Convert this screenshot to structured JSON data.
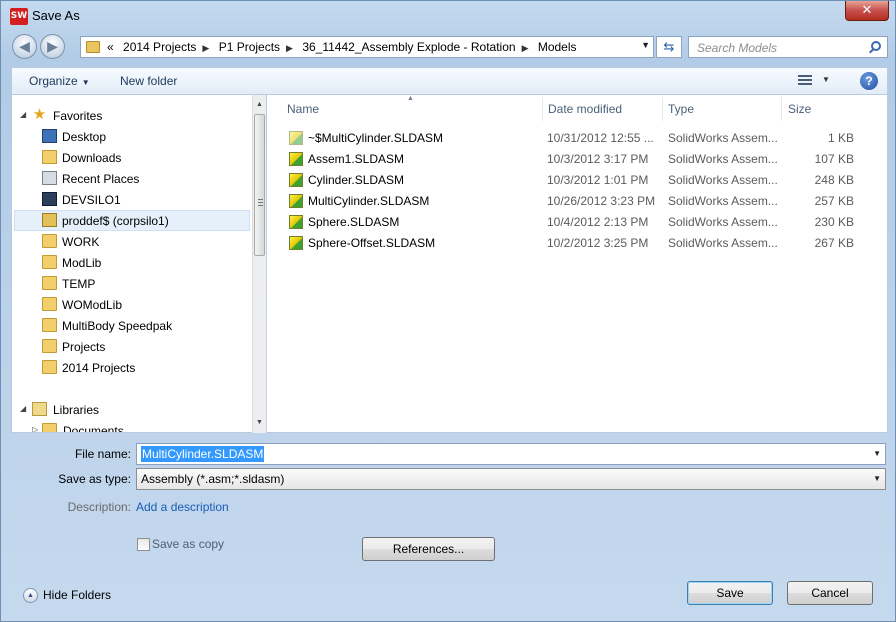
{
  "window": {
    "title": "Save As",
    "app_icon": "SW"
  },
  "address_bar": {
    "crumbs": [
      "«",
      "2014 Projects",
      "P1 Projects",
      "36_11442_Assembly Explode - Rotation",
      "Models"
    ],
    "search_placeholder": "Search Models"
  },
  "toolbar": {
    "organize_label": "Organize",
    "new_folder_label": "New folder"
  },
  "nav_pane": {
    "items": [
      {
        "label": "Favorites",
        "icon": "star-icon"
      },
      {
        "label": "Desktop",
        "icon": "desktop-icon"
      },
      {
        "label": "Downloads",
        "icon": "downloads-folder-icon"
      },
      {
        "label": "Recent Places",
        "icon": "recent-places-icon"
      },
      {
        "label": "DEVSILO1",
        "icon": "computer-icon"
      },
      {
        "label": "proddef$ (corpsilo1)",
        "icon": "network-drive-icon"
      },
      {
        "label": "WORK",
        "icon": "folder-icon"
      },
      {
        "label": "ModLib",
        "icon": "folder-icon"
      },
      {
        "label": "TEMP",
        "icon": "folder-icon"
      },
      {
        "label": "WOModLib",
        "icon": "folder-icon"
      },
      {
        "label": "MultiBody Speedpak",
        "icon": "folder-icon"
      },
      {
        "label": "Projects",
        "icon": "folder-icon"
      },
      {
        "label": "2014 Projects",
        "icon": "folder-icon"
      },
      {
        "label": "Libraries",
        "icon": "libraries-icon"
      },
      {
        "label": "Documents",
        "icon": "documents-icon"
      }
    ],
    "selected": "proddef$ (corpsilo1)"
  },
  "file_list": {
    "columns": [
      "Name",
      "Date modified",
      "Type",
      "Size"
    ],
    "rows": [
      {
        "name": "~$MultiCylinder.SLDASM",
        "date": "10/31/2012 12:55 ...",
        "type": "SolidWorks Assem...",
        "size": "1 KB"
      },
      {
        "name": "Assem1.SLDASM",
        "date": "10/3/2012 3:17 PM",
        "type": "SolidWorks Assem...",
        "size": "107 KB"
      },
      {
        "name": "Cylinder.SLDASM",
        "date": "10/3/2012 1:01 PM",
        "type": "SolidWorks Assem...",
        "size": "248 KB"
      },
      {
        "name": "MultiCylinder.SLDASM",
        "date": "10/26/2012 3:23 PM",
        "type": "SolidWorks Assem...",
        "size": "257 KB"
      },
      {
        "name": "Sphere.SLDASM",
        "date": "10/4/2012 2:13 PM",
        "type": "SolidWorks Assem...",
        "size": "230 KB"
      },
      {
        "name": "Sphere-Offset.SLDASM",
        "date": "10/2/2012 3:25 PM",
        "type": "SolidWorks Assem...",
        "size": "267 KB"
      }
    ]
  },
  "form": {
    "file_name_label": "File name:",
    "file_name_value": "MultiCylinder.SLDASM",
    "save_type_label": "Save as type:",
    "save_type_value": "Assembly (*.asm;*.sldasm)",
    "description_label": "Description:",
    "description_link": "Add a description",
    "save_copy_label": "Save as copy",
    "references_label": "References..."
  },
  "footer": {
    "hide_folders_label": "Hide Folders",
    "save_label": "Save",
    "cancel_label": "Cancel"
  }
}
